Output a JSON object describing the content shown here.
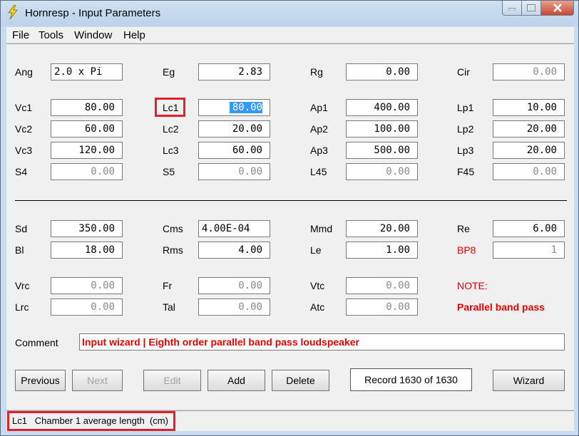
{
  "window": {
    "title": "Hornresp - Input Parameters"
  },
  "menu": {
    "file": "File",
    "tools": "Tools",
    "window": "Window",
    "help": "Help"
  },
  "params": {
    "ang": {
      "label": "Ang",
      "value": "2.0 x Pi"
    },
    "eg": {
      "label": "Eg",
      "value": "2.83"
    },
    "rg": {
      "label": "Rg",
      "value": "0.00"
    },
    "cir": {
      "label": "Cir",
      "value": "0.00"
    },
    "vc1": {
      "label": "Vc1",
      "value": "80.00"
    },
    "lc1": {
      "label": "Lc1",
      "value": "80.00"
    },
    "ap1": {
      "label": "Ap1",
      "value": "400.00"
    },
    "lp1": {
      "label": "Lp1",
      "value": "10.00"
    },
    "vc2": {
      "label": "Vc2",
      "value": "60.00"
    },
    "lc2": {
      "label": "Lc2",
      "value": "20.00"
    },
    "ap2": {
      "label": "Ap2",
      "value": "100.00"
    },
    "lp2": {
      "label": "Lp2",
      "value": "20.00"
    },
    "vc3": {
      "label": "Vc3",
      "value": "120.00"
    },
    "lc3": {
      "label": "Lc3",
      "value": "60.00"
    },
    "ap3": {
      "label": "Ap3",
      "value": "500.00"
    },
    "lp3": {
      "label": "Lp3",
      "value": "20.00"
    },
    "s4": {
      "label": "S4",
      "value": "0.00"
    },
    "s5": {
      "label": "S5",
      "value": "0.00"
    },
    "l45": {
      "label": "L45",
      "value": "0.00"
    },
    "f45": {
      "label": "F45",
      "value": "0.00"
    },
    "sd": {
      "label": "Sd",
      "value": "350.00"
    },
    "cms": {
      "label": "Cms",
      "value": "4.00E-04"
    },
    "mmd": {
      "label": "Mmd",
      "value": "20.00"
    },
    "re": {
      "label": "Re",
      "value": "6.00"
    },
    "bl": {
      "label": "Bl",
      "value": "18.00"
    },
    "rms": {
      "label": "Rms",
      "value": "4.00"
    },
    "le": {
      "label": "Le",
      "value": "1.00"
    },
    "bp8": {
      "label": "BP8",
      "value": "1"
    },
    "vrc": {
      "label": "Vrc",
      "value": "0.00"
    },
    "fr": {
      "label": "Fr",
      "value": "0.00"
    },
    "vtc": {
      "label": "Vtc",
      "value": "0.00"
    },
    "lrc": {
      "label": "Lrc",
      "value": "0.00"
    },
    "tal": {
      "label": "Tal",
      "value": "0.00"
    },
    "atc": {
      "label": "Atc",
      "value": "0.00"
    }
  },
  "note": {
    "label": "NOTE:",
    "text": "Parallel band pass"
  },
  "comment": {
    "label": "Comment",
    "value": "Input wizard | Eighth order parallel band pass loudspeaker"
  },
  "buttons": {
    "previous": "Previous",
    "next": "Next",
    "edit": "Edit",
    "add": "Add",
    "delete": "Delete",
    "wizard": "Wizard"
  },
  "record": "Record 1630 of 1630",
  "status": "Lc1   Chamber 1 average length  (cm)",
  "colors": {
    "highlight": "#e0202a",
    "accent_label": "#e00000",
    "selection": "#3399ff"
  }
}
